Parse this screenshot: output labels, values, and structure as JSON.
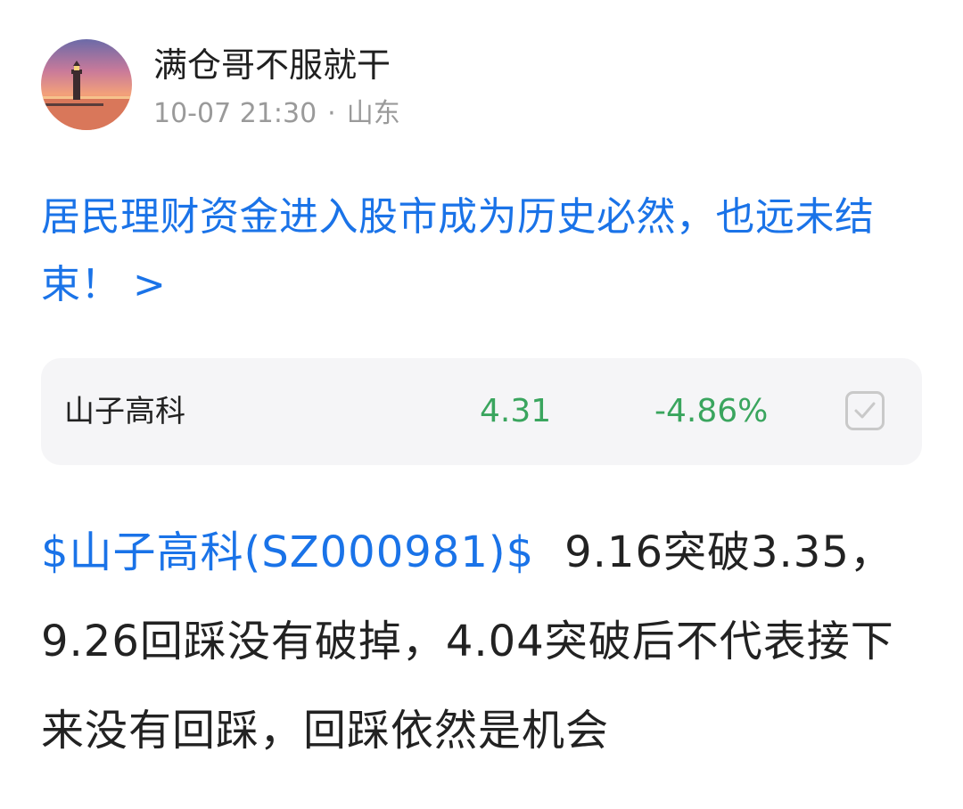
{
  "post": {
    "author": "满仓哥不服就干",
    "time": "10-07 21:30",
    "separator": "·",
    "location": "山东",
    "avatar_icon": "lighthouse-sunset-avatar",
    "title": "居民理财资金进入股市成为历史必然，也远未结束！",
    "title_chevron": ">",
    "stock": {
      "name": "山子高科",
      "price": "4.31",
      "change": "-4.86%",
      "color": "#3aa55e",
      "check_icon": "checkbox-icon"
    },
    "cashtag": "$山子高科(SZ000981)$",
    "content": "9.16突破3.35，9.26回踩没有破掉，4.04突破后不代表接下来没有回踩，回踩依然是机会"
  },
  "colors": {
    "link": "#1a73e8",
    "muted": "#9a9a9a",
    "card_bg": "#f5f5f7"
  }
}
